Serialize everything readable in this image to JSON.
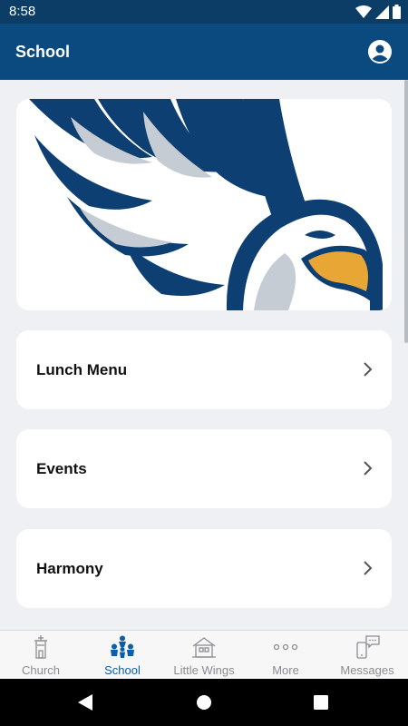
{
  "status_bar": {
    "time": "8:58"
  },
  "app_bar": {
    "title": "School"
  },
  "hero": {
    "image": "eagle-mascot-logo"
  },
  "cards": [
    {
      "label": "Lunch Menu"
    },
    {
      "label": "Events"
    },
    {
      "label": "Harmony"
    }
  ],
  "tabs": [
    {
      "label": "Church",
      "icon": "church-icon",
      "active": false
    },
    {
      "label": "School",
      "icon": "school-people-icon",
      "active": true
    },
    {
      "label": "Little Wings",
      "icon": "house-icon",
      "active": false
    },
    {
      "label": "More",
      "icon": "more-dots-icon",
      "active": false
    },
    {
      "label": "Messages",
      "icon": "messages-icon",
      "active": false
    }
  ],
  "colors": {
    "primary": "#0b4a7e",
    "active_tab": "#0b5ea8",
    "inactive_tab": "#8a8d91",
    "background": "#eef0f3"
  }
}
